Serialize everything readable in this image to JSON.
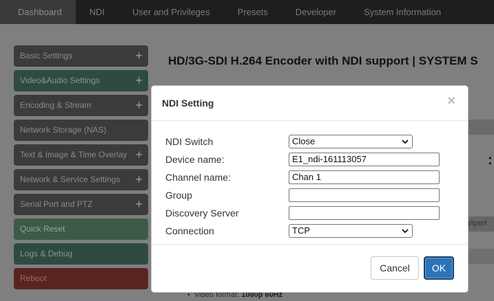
{
  "nav": {
    "tabs": [
      "Dashboard",
      "NDI",
      "User and Privileges",
      "Presets",
      "Developer",
      "System Information"
    ]
  },
  "sidebar": {
    "items": [
      {
        "label": "Basic Settings",
        "expand": "+"
      },
      {
        "label": "Video&Audio Settings",
        "expand": "+"
      },
      {
        "label": "Encoding & Stream",
        "expand": "+"
      },
      {
        "label": "Network Storage (NAS)",
        "expand": ""
      },
      {
        "label": "Text & Image & Time Overlay",
        "expand": "+"
      },
      {
        "label": "Network & Service Settings",
        "expand": "+"
      },
      {
        "label": "Serial Port and PTZ",
        "expand": "+"
      },
      {
        "label": "Quick Reset",
        "expand": ""
      },
      {
        "label": "Logs & Debug",
        "expand": ""
      },
      {
        "label": "Reboot",
        "expand": ""
      }
    ]
  },
  "page": {
    "title": "HD/3G-SDI H.264 Encoder with NDI support | SYSTEM S",
    "url_fragment": "g/iperf",
    "bullet_label": "Video format: ",
    "bullet_value": "1080p 60Hz",
    "colon": ":"
  },
  "modal": {
    "title": "NDI Setting",
    "close": "×",
    "fields": {
      "ndi_switch": {
        "label": "NDI Switch",
        "value": "Close"
      },
      "device_name": {
        "label": "Device name:",
        "value": "E1_ndi-161113057"
      },
      "channel_name": {
        "label": "Channel name:",
        "value": "Chan 1"
      },
      "group": {
        "label": "Group",
        "value": ""
      },
      "discovery_server": {
        "label": "Discovery Server",
        "value": ""
      },
      "connection": {
        "label": "Connection",
        "value": "TCP"
      }
    },
    "cancel_label": "Cancel",
    "ok_label": "OK"
  },
  "colors": {
    "primary_button": "#2d73b8",
    "reboot": "#5a2320",
    "quick_reset": "#3c5a47"
  }
}
